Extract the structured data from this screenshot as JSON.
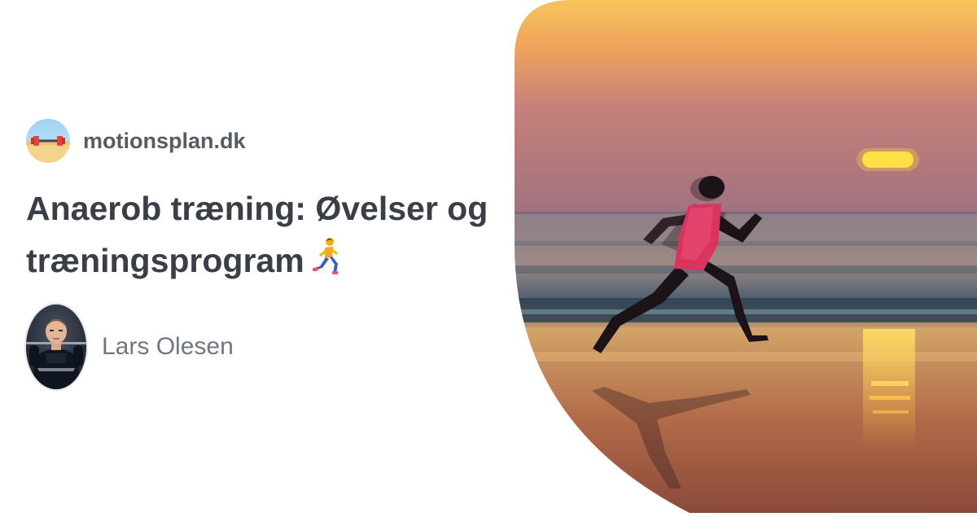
{
  "site": {
    "name": "motionsplan.dk",
    "logo_icon": "beach-dumbbell-logo-icon"
  },
  "article": {
    "title": "Anaerob træning: Øvelser og træningsprogram",
    "title_emoji": "person-running-icon"
  },
  "author": {
    "name": "Lars Olesen",
    "avatar_icon": "author-photo"
  },
  "hero": {
    "image": "runner-on-beach-at-sunset"
  },
  "colors": {
    "background": "#ffffff",
    "site_name": "#555c66",
    "title": "#3a3f47",
    "author_name": "#707784"
  }
}
